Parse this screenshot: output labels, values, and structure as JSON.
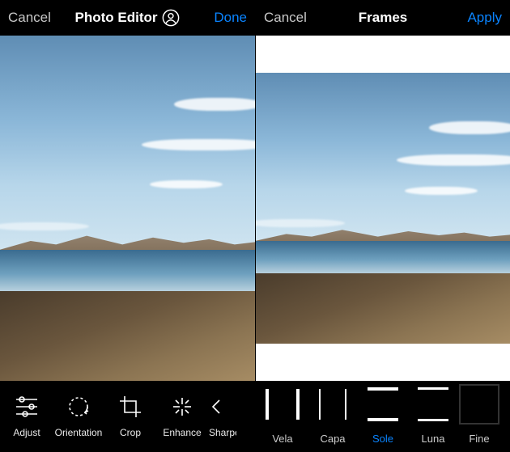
{
  "left": {
    "header": {
      "cancel": "Cancel",
      "title": "Photo Editor",
      "done": "Done"
    },
    "tools": [
      {
        "label": "Adjust"
      },
      {
        "label": "Orientation"
      },
      {
        "label": "Crop"
      },
      {
        "label": "Enhance"
      },
      {
        "label": "Sharpen"
      }
    ]
  },
  "right": {
    "header": {
      "cancel": "Cancel",
      "title": "Frames",
      "apply": "Apply"
    },
    "frames": [
      {
        "label": "Vela"
      },
      {
        "label": "Capa"
      },
      {
        "label": "Sole",
        "selected": true
      },
      {
        "label": "Luna"
      },
      {
        "label": "Fine"
      }
    ]
  }
}
